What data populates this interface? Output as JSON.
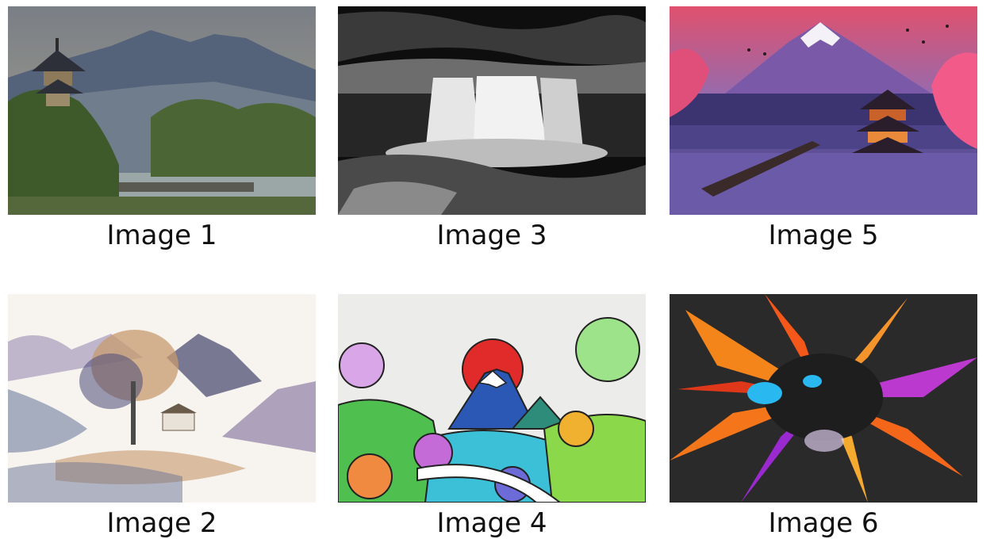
{
  "images": [
    {
      "caption": "Image 1",
      "subject": "pagoda-lake-mountains"
    },
    {
      "caption": "Image 2",
      "subject": "watercolor-tree-mountains"
    },
    {
      "caption": "Image 3",
      "subject": "black-and-white-waterfall"
    },
    {
      "caption": "Image 4",
      "subject": "pop-art-mount-fuji"
    },
    {
      "caption": "Image 5",
      "subject": "anime-fuji-pagoda-night"
    },
    {
      "caption": "Image 6",
      "subject": "color-explosion"
    }
  ]
}
